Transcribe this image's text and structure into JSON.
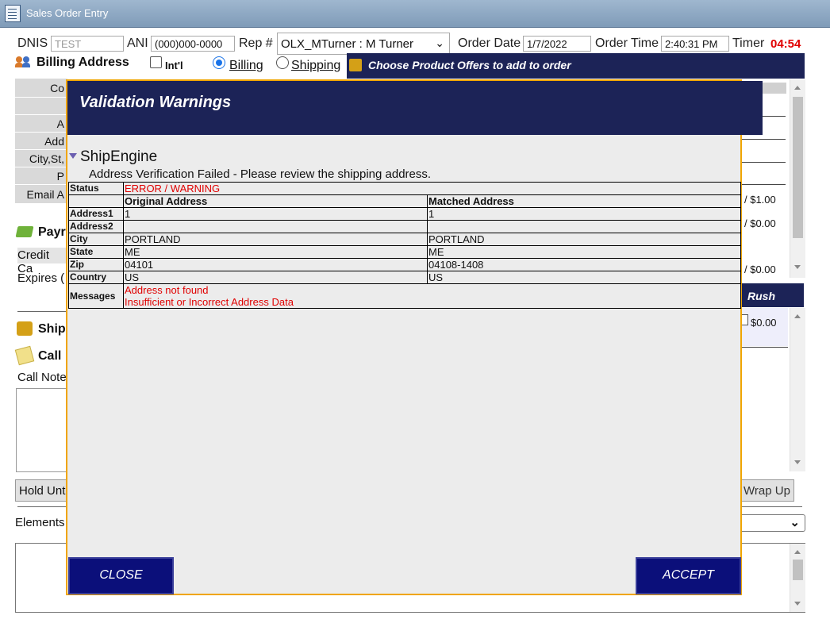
{
  "window": {
    "title": "Sales Order Entry"
  },
  "header": {
    "dnis_label": "DNIS",
    "dnis_placeholder": "TEST",
    "ani_label": "ANI",
    "ani_value": "(000)000-0000",
    "rep_label": "Rep #",
    "rep_value": "OLX_MTurner : M Turner",
    "order_date_label": "Order Date",
    "order_date_value": "1/7/2022",
    "order_time_label": "Order Time",
    "order_time_value": "2:40:31 PM",
    "timer_label": "Timer",
    "timer_value": "04:54"
  },
  "billing": {
    "title": "Billing Address",
    "intl_label": "Int'l",
    "radio_billing": "Billing",
    "radio_shipping": "Shipping",
    "field_labels": [
      "Co",
      "",
      "A",
      "Add",
      "City,St,",
      "P",
      "Email A"
    ]
  },
  "offers_panel": {
    "title": "Choose Product Offers to add to order",
    "prices": [
      "/ $1.00",
      "/ $0.00",
      "/ $0.00"
    ]
  },
  "payment": {
    "title": "Payr",
    "credit_label": "Credit Ca",
    "expires_label": "Expires ("
  },
  "shipping_section": {
    "title": "Ship",
    "rush_label": "Rush",
    "rush_price": "$0.00"
  },
  "call_notes": {
    "title": "Call",
    "label": "Call Note"
  },
  "bottom": {
    "hold_label": "Hold Unt",
    "wrap_up_label": "Wrap Up",
    "elements_label": "Elements"
  },
  "modal": {
    "title": "Validation Warnings",
    "provider": "ShipEngine",
    "message": "Address Verification Failed - Please review the shipping address.",
    "status_label": "Status",
    "status_value": "ERROR / WARNING",
    "col_original": "Original Address",
    "col_matched": "Matched Address",
    "rows": [
      {
        "label": "Address1",
        "original": "1",
        "matched": "1"
      },
      {
        "label": "Address2",
        "original": "",
        "matched": ""
      },
      {
        "label": "City",
        "original": "PORTLAND",
        "matched": "PORTLAND"
      },
      {
        "label": "State",
        "original": "ME",
        "matched": "ME"
      },
      {
        "label": "Zip",
        "original": "04101",
        "matched": "04108-1408"
      },
      {
        "label": "Country",
        "original": "US",
        "matched": "US"
      }
    ],
    "messages_label": "Messages",
    "messages": [
      "Address not found",
      "Insufficient or Incorrect Address Data"
    ],
    "close_label": "CLOSE",
    "accept_label": "ACCEPT"
  },
  "colors": {
    "navy": "#1c2357",
    "modal_border": "#f0a500",
    "timer_red": "#e00000",
    "button_navy": "#0b0f7a"
  }
}
